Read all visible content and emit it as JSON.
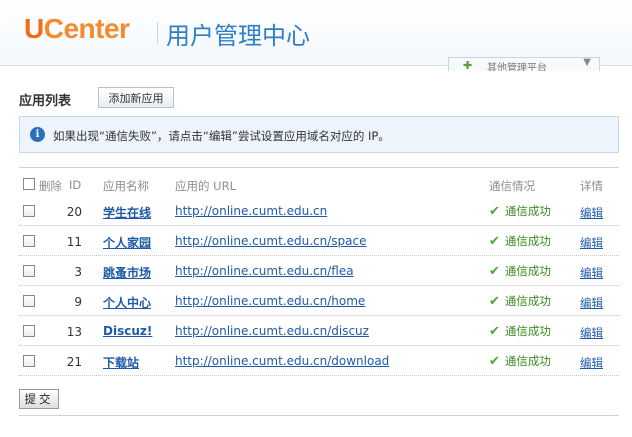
{
  "header": {
    "logo_u": "U",
    "logo_rest": "Center",
    "title": "用户管理中心",
    "other_panel_label": "其他管理平台",
    "other_panel_arrow": "▼"
  },
  "section": {
    "title": "应用列表",
    "add_button": "添加新应用"
  },
  "notice": {
    "icon": "i",
    "text": "如果出现“通信失败”，请点击“编辑”尝试设置应用域名对应的 IP。"
  },
  "table": {
    "headers": {
      "delete": "删除",
      "id": "ID",
      "name": "应用名称",
      "url": "应用的 URL",
      "status": "通信情况",
      "detail": "详情"
    },
    "rows": [
      {
        "id": "20",
        "name": "学生在线",
        "url": "http://online.cumt.edu.cn",
        "status": "通信成功",
        "edit": "编辑"
      },
      {
        "id": "11",
        "name": "个人家园",
        "url": "http://online.cumt.edu.cn/space",
        "status": "通信成功",
        "edit": "编辑"
      },
      {
        "id": "3",
        "name": "跳蚤市场",
        "url": "http://online.cumt.edu.cn/flea",
        "status": "通信成功",
        "edit": "编辑"
      },
      {
        "id": "9",
        "name": "个人中心",
        "url": "http://online.cumt.edu.cn/home",
        "status": "通信成功",
        "edit": "编辑"
      },
      {
        "id": "13",
        "name": "Discuz!",
        "url": "http://online.cumt.edu.cn/discuz",
        "status": "通信成功",
        "edit": "编辑"
      },
      {
        "id": "21",
        "name": "下载站",
        "url": "http://online.cumt.edu.cn/download",
        "status": "通信成功",
        "edit": "编辑"
      }
    ]
  },
  "submit_button": "提交",
  "icons": {
    "status_ok": "✔",
    "panel_plus": "✚"
  }
}
